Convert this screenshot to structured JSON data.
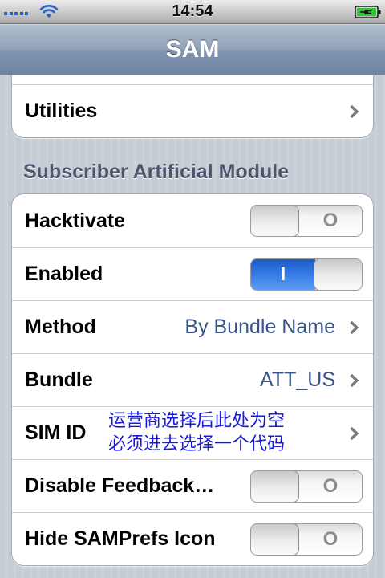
{
  "status_bar": {
    "time": "14:54",
    "signal_icon": "signal-dots-icon",
    "wifi_icon": "wifi-icon",
    "battery_icon": "battery-charging-icon"
  },
  "nav_bar": {
    "title": "SAM"
  },
  "top_group": {
    "utilities": {
      "label": "Utilities",
      "accessory": "chevron-right-icon"
    }
  },
  "section": {
    "header": "Subscriber Artificial Module",
    "rows": [
      {
        "label": "Hacktivate",
        "on": false
      },
      {
        "label": "Enabled",
        "on": true
      },
      {
        "label": "Method",
        "value": "By Bundle Name",
        "accessory": "chevron-right-icon"
      },
      {
        "label": "Bundle",
        "value": "ATT_US",
        "accessory": "chevron-right-icon"
      },
      {
        "label": "SIM ID",
        "accessory": "chevron-right-icon",
        "annotation": [
          "运营商选择后此处为空",
          "必须进去选择一个代码"
        ]
      },
      {
        "label": "Disable Feedback…",
        "on": false
      },
      {
        "label": "Hide SAMPrefs Icon",
        "on": false
      }
    ]
  },
  "switch_labels": {
    "on": "I",
    "off": "O"
  },
  "colors": {
    "nav_bar": "#6d84a2",
    "section_header": "#4c566c",
    "value_text": "#385487",
    "switch_on": "#3479e4",
    "annotation_text": "#1a1ad9",
    "battery_fill": "#36c236",
    "status_icons": "#2a62c0"
  }
}
